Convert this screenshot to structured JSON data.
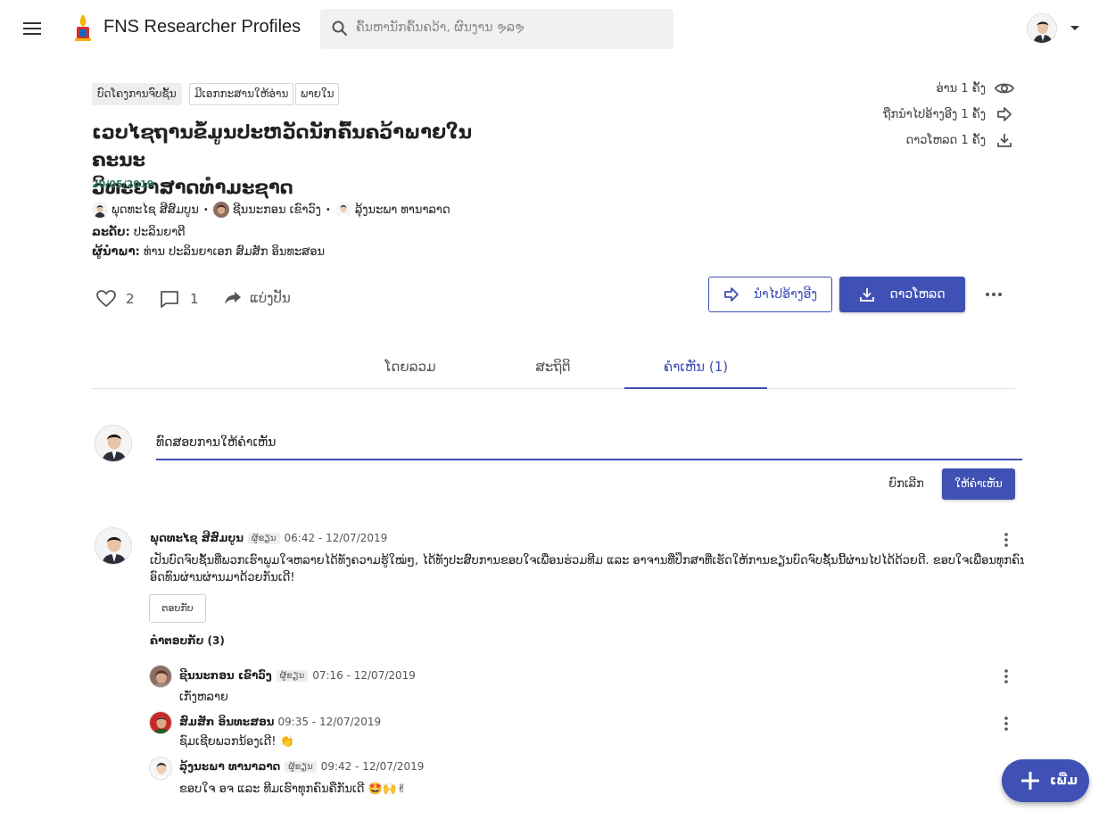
{
  "header": {
    "app_title": "FNS Researcher Profiles",
    "search_placeholder": "ຄົ້ນຫານັກຄົ້ນຄວ້າ, ຜົນງານ ຯລຯ"
  },
  "document": {
    "tags": [
      "ບົດໂຄງການຈົບຊັ້ນ",
      "ມີເອກກະສານໃຫ້ອ່ານ",
      "ພາຍໃນ"
    ],
    "title_line1": "ເວບໄຊຖານຂໍ້ມູນປະຫວັດນັກຄົ້ນຄວ້າພາຍໃນຄະນະ",
    "title_line2": "ວິທະຍາສາດທຳມະຊາດ",
    "date": "20/05/2019",
    "authors": [
      "ພຸດທະໄຊ ສີສົມບູນ",
      "ຊີນນະກອນ ເຂົາວົງ",
      "ລຸ້ງນະພາ ທານາລາດ"
    ],
    "level_label": "ລະດັບ:",
    "level_value": "ປະລິນຍາຕີ",
    "advisor_label": "ຜູ້ນຳພາ:",
    "advisor_value": "ທ່ານ ປະລິນຍາເອກ ສົມສັກ ອິນທະສອນ"
  },
  "stats": {
    "reads": "ອ່ານ 1 ຄັ້ງ",
    "citations": "ຖືກນຳໄປອ້າງອີງ 1 ຄັ້ງ",
    "downloads": "ດາວໂຫລດ 1 ຄັ້ງ"
  },
  "actions": {
    "likes": "2",
    "comments": "1",
    "share_label": "ແບ່ງປັນ",
    "cite_label": "ນຳໄປອ້າງອີງ",
    "download_label": "ດາວໂຫລດ"
  },
  "tabs": [
    {
      "label": "ໂດຍລວມ",
      "active": false
    },
    {
      "label": "ສະຖິຕິ",
      "active": false
    },
    {
      "label": "ຄຳເຫັນ (1)",
      "active": true
    }
  ],
  "comment_input": {
    "value": "ທົດສອບການໃຫ້ຄຳເຫັນ",
    "cancel_label": "ຍົກເລີກ",
    "submit_label": "ໃຫ້ຄຳເຫັນ"
  },
  "comment": {
    "author": "ພຸດທະໄຊ ສີສົມບູນ",
    "badge": "ຜູ້ຂຽນ",
    "time": "06:42 - 12/07/2019",
    "text_line1": "ເປັນບົດຈົບຊັ້ນທີ່ພວກເຮົາພູມໃຈຫລາຍໄດ້ທັງຄວາມຮູ້ໃໝ່ໆ, ໄດ້ທັງປະສົບການຂອບໃຈເພື່ອນຮ່ວມທີມ ແລະ ອາຈານທີ່ປຶກສາທີ່ເຮັດໃຫ້ການຂຽນບົດຈົບຊັ້ນນີ້ຜ່ານໄປໄດ້ດ້ວຍດີ. ຂອບໃຈເພື່ອນທຸກຄົນທີ່",
    "text_line2": "ອົດທົນຜ່ານຜ່ານມາດ້ວຍກັນເດີ!",
    "reply_label": "ຕອບກັບ",
    "replies_count": "ຄຳຕອບກັບ (3)"
  },
  "replies": [
    {
      "author": "ຊີນນະກອນ ເຂົາວົງ",
      "badge": "ຜູ້ຂຽນ",
      "time": "07:16 - 12/07/2019",
      "text": "ເກັ່ງຫລາຍ"
    },
    {
      "author": "ສົມສັກ ອິນທະສອນ",
      "badge": "",
      "time": "09:35 - 12/07/2019",
      "text": "ຊົມເຊີຍພວກນ້ອງເດີ! 👏"
    },
    {
      "author": "ລຸ້ງນະພາ ທານາລາດ",
      "badge": "ຜູ້ຂຽນ",
      "time": "09:42 - 12/07/2019",
      "text": "ຂອບໃຈ ອຈ ແລະ ທີມເຮົາທຸກຄົນຄືກັນເດີ 🤩🙌✌"
    }
  ],
  "fab": {
    "label": "ເພີ່ມ"
  },
  "colors": {
    "primary": "#3f51b5",
    "date_green": "#2e7d5b"
  },
  "icons": [
    "menu-icon",
    "logo-icon",
    "search-icon",
    "eye-icon",
    "forward-icon",
    "download-icon",
    "heart-icon",
    "comment-icon",
    "share-icon",
    "more-horizontal-icon",
    "more-vertical-icon",
    "plus-icon"
  ]
}
